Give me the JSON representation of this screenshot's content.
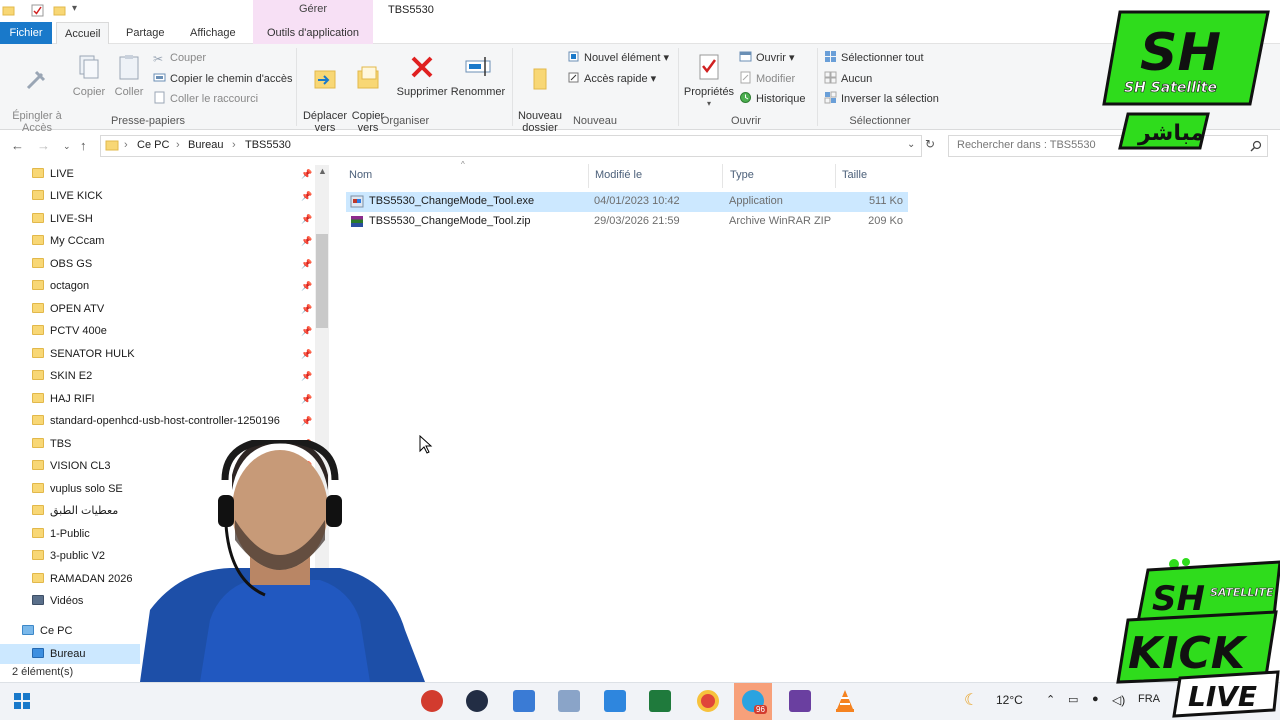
{
  "window": {
    "title": "TBS5530",
    "contextual_group": "Gérer",
    "tabs": [
      {
        "label": "Fichier"
      },
      {
        "label": "Accueil"
      },
      {
        "label": "Partage"
      },
      {
        "label": "Affichage"
      },
      {
        "label": "Outils d'application"
      }
    ]
  },
  "ribbon": {
    "presse_papiers": {
      "label": "Presse-papiers",
      "epingler": "Épingler à\nAccès rapide",
      "copier": "Copier",
      "coller": "Coller",
      "couper": "Couper",
      "copier_chemin": "Copier le chemin d'accès",
      "coller_raccourci": "Coller le raccourci"
    },
    "organiser": {
      "label": "Organiser",
      "deplacer": "Déplacer\nvers",
      "copier_vers": "Copier\nvers",
      "supprimer": "Supprimer",
      "renommer": "Renommer"
    },
    "nouveau": {
      "label": "Nouveau",
      "nouveau_dossier": "Nouveau\ndossier",
      "nouvel_element": "Nouvel élément",
      "acces_rapide": "Accès rapide"
    },
    "ouvrir": {
      "label": "Ouvrir",
      "proprietes": "Propriétés",
      "ouvrir": "Ouvrir",
      "modifier": "Modifier",
      "historique": "Historique"
    },
    "selectionner": {
      "label": "Sélectionner",
      "tout": "Sélectionner tout",
      "aucun": "Aucun",
      "inverser": "Inverser la sélection"
    }
  },
  "address": {
    "crumbs": [
      "Ce PC",
      "Bureau",
      "TBS5530"
    ],
    "search_placeholder": "Rechercher dans : TBS5530"
  },
  "nav": {
    "items": [
      "LIVE",
      "LIVE KICK",
      "LIVE-SH",
      "My CCcam",
      "OBS GS",
      "octagon",
      "OPEN ATV",
      "PCTV 400e",
      "SENATOR HULK",
      "SKIN E2",
      "HAJ RIFI",
      "standard-openhcd-usb-host-controller-1250196",
      "TBS",
      "VISION CL3",
      "vuplus solo SE",
      "معطيات الطبق",
      "1-Public",
      "3-public V2",
      "RAMADAN 2026",
      "Vidéos"
    ],
    "ce_pc": "Ce PC",
    "bureau": "Bureau"
  },
  "columns": {
    "nom": "Nom",
    "modifie": "Modifié le",
    "type": "Type",
    "taille": "Taille"
  },
  "files": [
    {
      "name": "TBS5530_ChangeMode_Tool.exe",
      "modified": "04/01/2023 10:42",
      "type": "Application",
      "size": "511 Ko",
      "selected": true
    },
    {
      "name": "TBS5530_ChangeMode_Tool.zip",
      "modified": "29/03/2026 21:59",
      "type": "Archive WinRAR ZIP",
      "size": "209 Ko",
      "selected": false
    }
  ],
  "status": {
    "count": "2 élément(s)"
  },
  "taskbar": {
    "temperature": "12°C",
    "language": "FRA",
    "badge": "96"
  },
  "overlay": {
    "logo_top_main": "SH",
    "logo_top_sub": "SH Satellite",
    "logo_top_arabic": "مباشر",
    "logo_bottom_main": "KICK",
    "logo_bottom_sub": "SATELLITE",
    "logo_bottom_live": "LIVE"
  },
  "colors": {
    "accent": "#1979ca",
    "selection": "#cce8ff",
    "contextual": "#f7e0f5",
    "logo_green": "#2fdc1c"
  }
}
